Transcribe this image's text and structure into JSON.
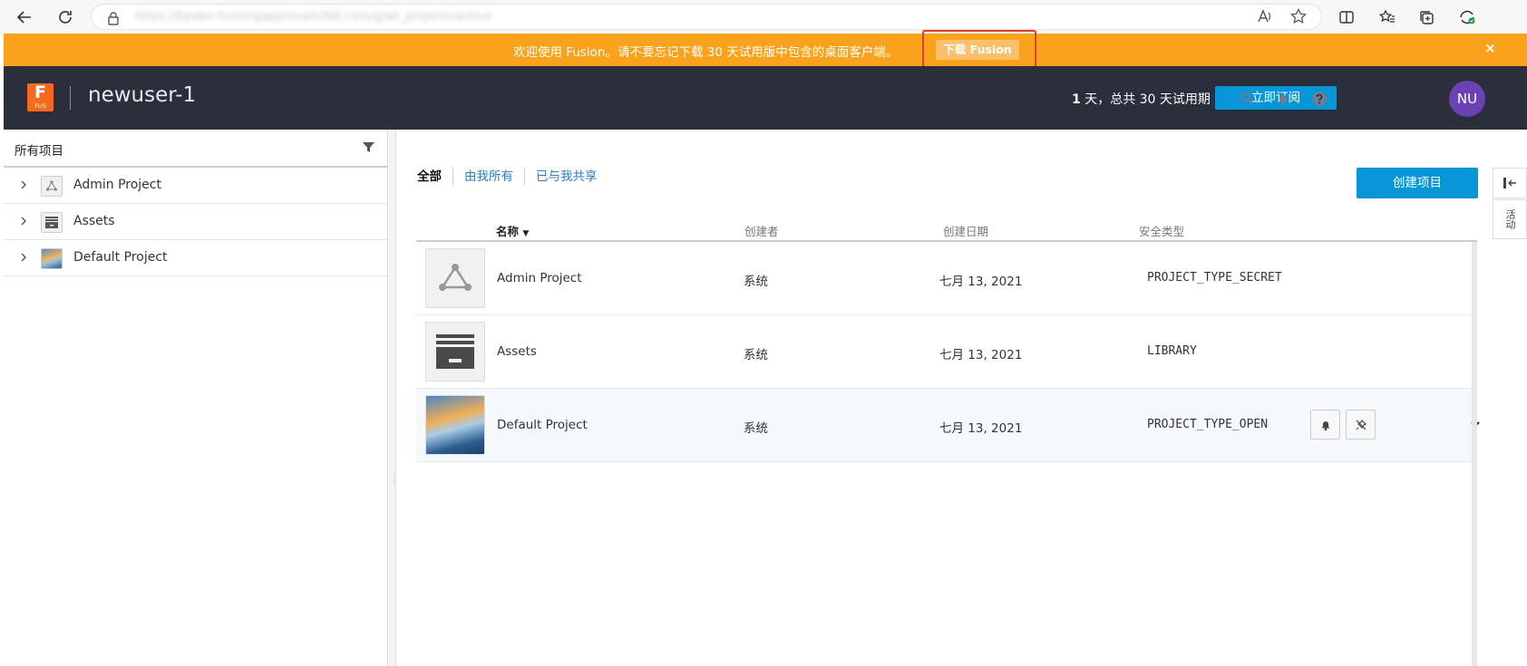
{
  "browser": {
    "url": "https://bpdev-fusiongapprovals360.com/g/all_projects/active",
    "read_aloud_icon": "read-aloud-icon",
    "favorite_icon": "star-icon"
  },
  "banner": {
    "message": "欢迎使用 Fusion。请不要忘记下载 30 天试用版中包含的桌面客户端。",
    "download_label": "下载 Fusion",
    "close_label": "×"
  },
  "header": {
    "logo_letter": "F",
    "logo_sub": "FUS",
    "username": "newuser-1",
    "trial_prefix": "1",
    "trial_text": " 天，总共 30 天试用期",
    "subscribe_label": "立即订阅",
    "avatar_initials": "NU"
  },
  "sidebar": {
    "title": "所有项目",
    "items": [
      {
        "label": "Admin Project"
      },
      {
        "label": "Assets"
      },
      {
        "label": "Default Project"
      }
    ]
  },
  "main": {
    "tabs": [
      {
        "label": "全部"
      },
      {
        "label": "由我所有"
      },
      {
        "label": "已与我共享"
      }
    ],
    "create_label": "创建项目",
    "side_tab_label": "活动",
    "columns": {
      "name": "名称",
      "sort_indicator": "▼",
      "creator": "创建者",
      "created": "创建日期",
      "security": "安全类型"
    },
    "rows": [
      {
        "name": "Admin Project",
        "creator": "系统",
        "date": "七月 13, 2021",
        "security": "PROJECT_TYPE_SECRET"
      },
      {
        "name": "Assets",
        "creator": "系统",
        "date": "七月 13, 2021",
        "security": "LIBRARY"
      },
      {
        "name": "Default Project",
        "creator": "系统",
        "date": "七月 13, 2021",
        "security": "PROJECT_TYPE_OPEN"
      }
    ]
  }
}
